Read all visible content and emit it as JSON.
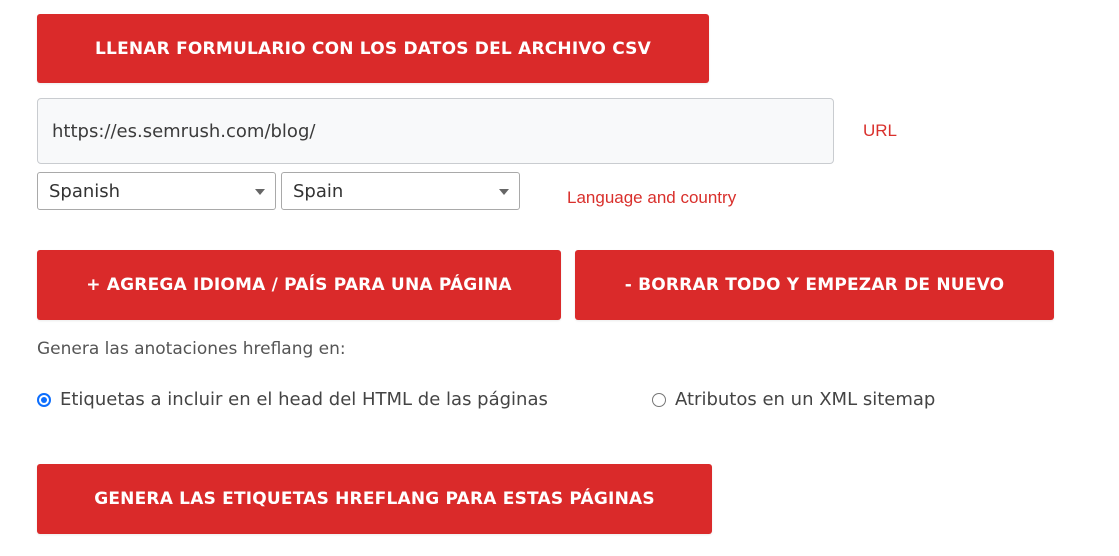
{
  "buttons": {
    "fill_csv": "LLENAR FORMULARIO CON LOS DATOS DEL ARCHIVO CSV",
    "add_language": "+ AGREGA IDIOMA / PAÍS PARA UNA PÁGINA",
    "clear_all": "- BORRAR TODO Y EMPEZAR DE NUEVO",
    "generate": "GENERA LAS ETIQUETAS HREFLANG PARA ESTAS PÁGINAS"
  },
  "url_field": {
    "value": "https://es.semrush.com/blog/",
    "label": "URL"
  },
  "selects": {
    "language": "Spanish",
    "country": "Spain",
    "label": "Language and country"
  },
  "output": {
    "intro": "Genera las anotaciones hreflang en:",
    "option_head": "Etiquetas a incluir en el head del HTML de las páginas",
    "option_xml": "Atributos en un XML sitemap",
    "selected": "head"
  },
  "colors": {
    "accent": "#da2a2a",
    "label_red": "#d9302c",
    "radio_blue": "#0d6efd"
  }
}
